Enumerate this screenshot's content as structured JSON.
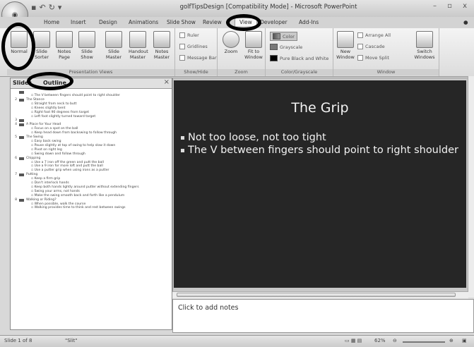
{
  "window": {
    "title": "golfTipsDesign [Compatibility Mode] - Microsoft PowerPoint",
    "controls": "– ▫ x"
  },
  "ribbon_tabs": [
    "Home",
    "Insert",
    "Design",
    "Animations",
    "Slide Show",
    "Review",
    "View",
    "Developer",
    "Add-Ins"
  ],
  "ribbon": {
    "presentation_views": {
      "label": "Presentation Views",
      "buttons": [
        "Normal",
        "Slide Sorter",
        "Notes Page",
        "Slide Show",
        "Slide Master",
        "Handout Master",
        "Notes Master"
      ]
    },
    "show_hide": {
      "label": "Show/Hide",
      "items": [
        "Ruler",
        "Gridlines",
        "Message Bar"
      ]
    },
    "zoom": {
      "label": "Zoom",
      "buttons": [
        "Zoom",
        "Fit to Window"
      ]
    },
    "color_grayscale": {
      "label": "Color/Grayscale",
      "items": [
        "Color",
        "Grayscale",
        "Pure Black and White"
      ]
    },
    "window": {
      "label": "Window",
      "buttons": [
        "New Window",
        "Arrange All",
        "Cascade",
        "Move Split",
        "Switch Windows"
      ]
    }
  },
  "pane": {
    "tabs": [
      "Slides",
      "Outline"
    ],
    "close": "×",
    "outline": [
      {
        "num": "",
        "title": "",
        "bullets": [
          "The V between fingers should point to right shoulder"
        ]
      },
      {
        "num": "2",
        "title": "The Stance",
        "bullets": [
          "Straight from neck to butt",
          "Knees slightly bent",
          "Right foot 90 degrees from target",
          "Left foot slightly turned toward target"
        ]
      },
      {
        "num": "3",
        "title": "",
        "bullets": []
      },
      {
        "num": "4",
        "title": "A Place for Your Head",
        "bullets": [
          "Focus on a spot on the ball",
          "Keep head down from backswing to follow through"
        ]
      },
      {
        "num": "5",
        "title": "The Swing",
        "bullets": [
          "Easy back swing",
          "Pause slightly at top of swing to help slow it down",
          "Pivot on right leg",
          "Swing down and follow through"
        ]
      },
      {
        "num": "6",
        "title": "Chipping",
        "bullets": [
          "Use a 7 iron off the green and putt the ball",
          "Use a 9 iron for more loft and putt the ball",
          "Use a putter grip when using irons as a putter"
        ]
      },
      {
        "num": "7",
        "title": "Putting",
        "bullets": [
          "Keep a firm grip",
          "Don't interlock hands",
          "Keep both hands lightly around putter without extending fingers",
          "Swing your arms, not hands",
          "Make the swing smooth back and forth like a pendulum"
        ]
      },
      {
        "num": "8",
        "title": "Walking or Riding?",
        "bullets": [
          "When possible, walk the course",
          "Walking provides time to think and rest between swings"
        ]
      }
    ]
  },
  "slide": {
    "title": "The Grip",
    "bullets": [
      "Not too loose, not too tight",
      "The V between fingers should point to right shoulder"
    ]
  },
  "notes": {
    "placeholder": "Click to add notes"
  },
  "status": {
    "slide": "Slide 1 of 8",
    "theme": "\"Slit\"",
    "zoom": "62%"
  },
  "colors": {
    "slide_bg": "#262626",
    "slide_text": "#f2f2f2",
    "highlight": "#000000"
  }
}
